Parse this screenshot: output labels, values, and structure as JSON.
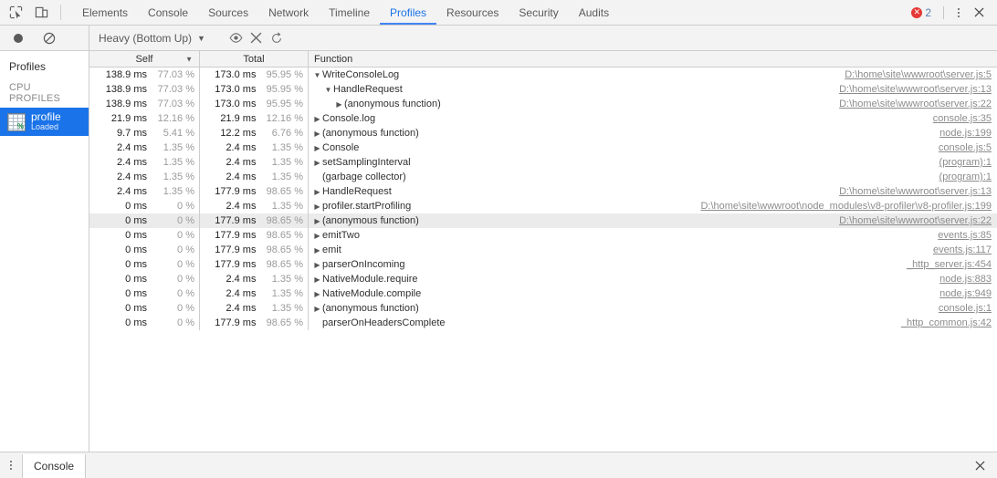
{
  "window": {
    "tabs": [
      {
        "label": "Elements",
        "active": false
      },
      {
        "label": "Console",
        "active": false
      },
      {
        "label": "Sources",
        "active": false
      },
      {
        "label": "Network",
        "active": false
      },
      {
        "label": "Timeline",
        "active": false
      },
      {
        "label": "Profiles",
        "active": true
      },
      {
        "label": "Resources",
        "active": false
      },
      {
        "label": "Security",
        "active": false
      },
      {
        "label": "Audits",
        "active": false
      }
    ],
    "error_count": "2",
    "accent_color": "#4285f4",
    "error_color": "#e53935"
  },
  "toolbar": {
    "record_label": "Record",
    "clear_label": "Clear all profiles",
    "view_mode": "Heavy (Bottom Up)",
    "caret": "▼",
    "focus_label": "Focus selected function",
    "exclude_label": "Exclude selected function",
    "restore_label": "Restore all functions"
  },
  "sidebar": {
    "title": "Profiles",
    "group_label": "CPU PROFILES",
    "items": [
      {
        "name": "profile",
        "status": "Loaded",
        "selected": true,
        "percent_glyph": "%"
      }
    ]
  },
  "grid": {
    "columns": [
      {
        "key": "self",
        "label": "Self",
        "sorted": true,
        "sort_arrow": "▼"
      },
      {
        "key": "total",
        "label": "Total",
        "sorted": false
      },
      {
        "key": "function",
        "label": "Function",
        "sorted": false
      }
    ],
    "rows": [
      {
        "self_ms": "138.9 ms",
        "self_pct": "77.03 %",
        "total_ms": "173.0 ms",
        "total_pct": "95.95 %",
        "depth": 0,
        "toggle": "▼",
        "name": "WriteConsoleLog",
        "link": "D:\\home\\site\\wwwroot\\server.js:5",
        "hovered": false
      },
      {
        "self_ms": "138.9 ms",
        "self_pct": "77.03 %",
        "total_ms": "173.0 ms",
        "total_pct": "95.95 %",
        "depth": 1,
        "toggle": "▼",
        "name": "HandleRequest",
        "link": "D:\\home\\site\\wwwroot\\server.js:13",
        "hovered": false
      },
      {
        "self_ms": "138.9 ms",
        "self_pct": "77.03 %",
        "total_ms": "173.0 ms",
        "total_pct": "95.95 %",
        "depth": 2,
        "toggle": "▶",
        "name": "(anonymous function)",
        "link": "D:\\home\\site\\wwwroot\\server.js:22",
        "hovered": false
      },
      {
        "self_ms": "21.9 ms",
        "self_pct": "12.16 %",
        "total_ms": "21.9 ms",
        "total_pct": "12.16 %",
        "depth": 0,
        "toggle": "▶",
        "name": "Console.log",
        "link": "console.js:35",
        "hovered": false
      },
      {
        "self_ms": "9.7 ms",
        "self_pct": "5.41 %",
        "total_ms": "12.2 ms",
        "total_pct": "6.76 %",
        "depth": 0,
        "toggle": "▶",
        "name": "(anonymous function)",
        "link": "node.js:199",
        "hovered": false
      },
      {
        "self_ms": "2.4 ms",
        "self_pct": "1.35 %",
        "total_ms": "2.4 ms",
        "total_pct": "1.35 %",
        "depth": 0,
        "toggle": "▶",
        "name": "Console",
        "link": "console.js:5",
        "hovered": false
      },
      {
        "self_ms": "2.4 ms",
        "self_pct": "1.35 %",
        "total_ms": "2.4 ms",
        "total_pct": "1.35 %",
        "depth": 0,
        "toggle": "▶",
        "name": "setSamplingInterval",
        "link": "(program):1",
        "hovered": false
      },
      {
        "self_ms": "2.4 ms",
        "self_pct": "1.35 %",
        "total_ms": "2.4 ms",
        "total_pct": "1.35 %",
        "depth": 0,
        "toggle": "",
        "name": "(garbage collector)",
        "link": "(program):1",
        "hovered": false
      },
      {
        "self_ms": "2.4 ms",
        "self_pct": "1.35 %",
        "total_ms": "177.9 ms",
        "total_pct": "98.65 %",
        "depth": 0,
        "toggle": "▶",
        "name": "HandleRequest",
        "link": "D:\\home\\site\\wwwroot\\server.js:13",
        "hovered": false
      },
      {
        "self_ms": "0 ms",
        "self_pct": "0 %",
        "total_ms": "2.4 ms",
        "total_pct": "1.35 %",
        "depth": 0,
        "toggle": "▶",
        "name": "profiler.startProfiling",
        "link": "D:\\home\\site\\wwwroot\\node_modules\\v8-profiler\\v8-profiler.js:199",
        "hovered": false
      },
      {
        "self_ms": "0 ms",
        "self_pct": "0 %",
        "total_ms": "177.9 ms",
        "total_pct": "98.65 %",
        "depth": 0,
        "toggle": "▶",
        "name": "(anonymous function)",
        "link": "D:\\home\\site\\wwwroot\\server.js:22",
        "hovered": true
      },
      {
        "self_ms": "0 ms",
        "self_pct": "0 %",
        "total_ms": "177.9 ms",
        "total_pct": "98.65 %",
        "depth": 0,
        "toggle": "▶",
        "name": "emitTwo",
        "link": "events.js:85",
        "hovered": false
      },
      {
        "self_ms": "0 ms",
        "self_pct": "0 %",
        "total_ms": "177.9 ms",
        "total_pct": "98.65 %",
        "depth": 0,
        "toggle": "▶",
        "name": "emit",
        "link": "events.js:117",
        "hovered": false
      },
      {
        "self_ms": "0 ms",
        "self_pct": "0 %",
        "total_ms": "177.9 ms",
        "total_pct": "98.65 %",
        "depth": 0,
        "toggle": "▶",
        "name": "parserOnIncoming",
        "link": "_http_server.js:454",
        "hovered": false
      },
      {
        "self_ms": "0 ms",
        "self_pct": "0 %",
        "total_ms": "2.4 ms",
        "total_pct": "1.35 %",
        "depth": 0,
        "toggle": "▶",
        "name": "NativeModule.require",
        "link": "node.js:883",
        "hovered": false
      },
      {
        "self_ms": "0 ms",
        "self_pct": "0 %",
        "total_ms": "2.4 ms",
        "total_pct": "1.35 %",
        "depth": 0,
        "toggle": "▶",
        "name": "NativeModule.compile",
        "link": "node.js:949",
        "hovered": false
      },
      {
        "self_ms": "0 ms",
        "self_pct": "0 %",
        "total_ms": "2.4 ms",
        "total_pct": "1.35 %",
        "depth": 0,
        "toggle": "▶",
        "name": "(anonymous function)",
        "link": "console.js:1",
        "hovered": false
      },
      {
        "self_ms": "0 ms",
        "self_pct": "0 %",
        "total_ms": "177.9 ms",
        "total_pct": "98.65 %",
        "depth": 0,
        "toggle": "",
        "name": "parserOnHeadersComplete",
        "link": "_http_common.js:42",
        "hovered": false
      }
    ]
  },
  "drawer": {
    "tabs": [
      {
        "label": "Console",
        "active": true
      }
    ],
    "close_label": "✕"
  }
}
